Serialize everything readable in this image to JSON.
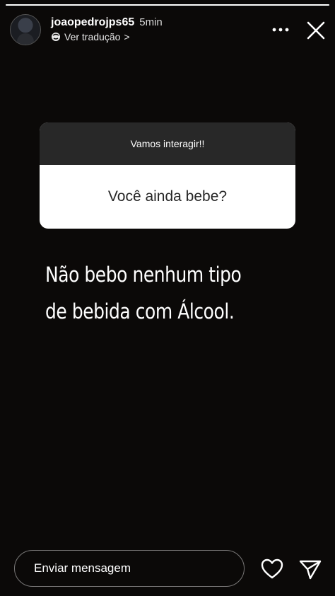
{
  "story": {
    "progress": 1.0
  },
  "header": {
    "username": "joaopedrojps65",
    "timestamp": "5min",
    "translate_label": "Ver tradução",
    "translate_chevron": ">"
  },
  "question": {
    "title": "Vamos interagir!!",
    "text": "Você ainda bebe?"
  },
  "answer": {
    "text": "Não bebo nenhum tipo de bebida com Álcool."
  },
  "footer": {
    "message_placeholder": "Enviar mensagem"
  },
  "icons": {
    "more": "more-horizontal-icon",
    "close": "close-icon",
    "translate": "translate-globe-icon",
    "like": "heart-icon",
    "send": "send-icon"
  },
  "colors": {
    "background": "#0b0908",
    "question_header": "#282828",
    "question_body": "#ffffff",
    "question_text": "#262626"
  }
}
